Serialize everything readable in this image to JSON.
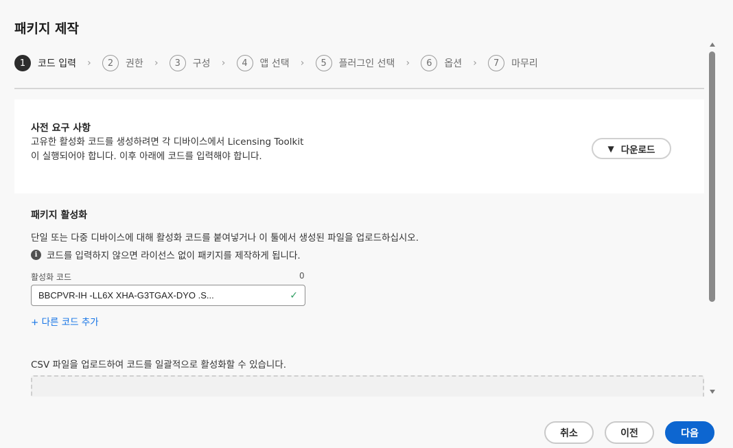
{
  "dialog": {
    "title": "패키지 제작"
  },
  "steps": [
    {
      "num": "1",
      "label": "코드 입력"
    },
    {
      "num": "2",
      "label": "권한"
    },
    {
      "num": "3",
      "label": "구성"
    },
    {
      "num": "4",
      "label": "앱 선택"
    },
    {
      "num": "5",
      "label": "플러그인 선택"
    },
    {
      "num": "6",
      "label": "옵션"
    },
    {
      "num": "7",
      "label": "마무리"
    }
  ],
  "prereq": {
    "title": "사전 요구 사항",
    "description": "고유한 활성화 코드를 생성하려면 각 디바이스에서 Licensing Toolkit이 실행되어야 합니다. 이후 아래에 코드를 입력해야 합니다.",
    "download_label": "다운로드"
  },
  "activation": {
    "title": "패키지 활성화",
    "description": "단일 또는 다중 디바이스에 대해 활성화 코드를 붙여넣거나 이 툴에서 생성된 파일을 업로드하십시오.",
    "info": "코드를 입력하지 않으면 라이선스 없이 패키지를 제작하게 됩니다.",
    "field_label": "활성화 코드",
    "field_count": "0",
    "code_value": "BBCPVR-IH       -LL6X            XHA-G3TGAX-DYO   .S...",
    "add_code_label": "+ 다른 코드 추가",
    "csv_description": "CSV 파일을 업로드하여 코드를 일괄적으로 활성화할 수 있습니다."
  },
  "footer": {
    "cancel_label": "취소",
    "prev_label": "이전",
    "next_label": "다음"
  },
  "colors": {
    "primary": "#0d66d0",
    "link": "#1473e6",
    "success": "#2d9d61"
  }
}
